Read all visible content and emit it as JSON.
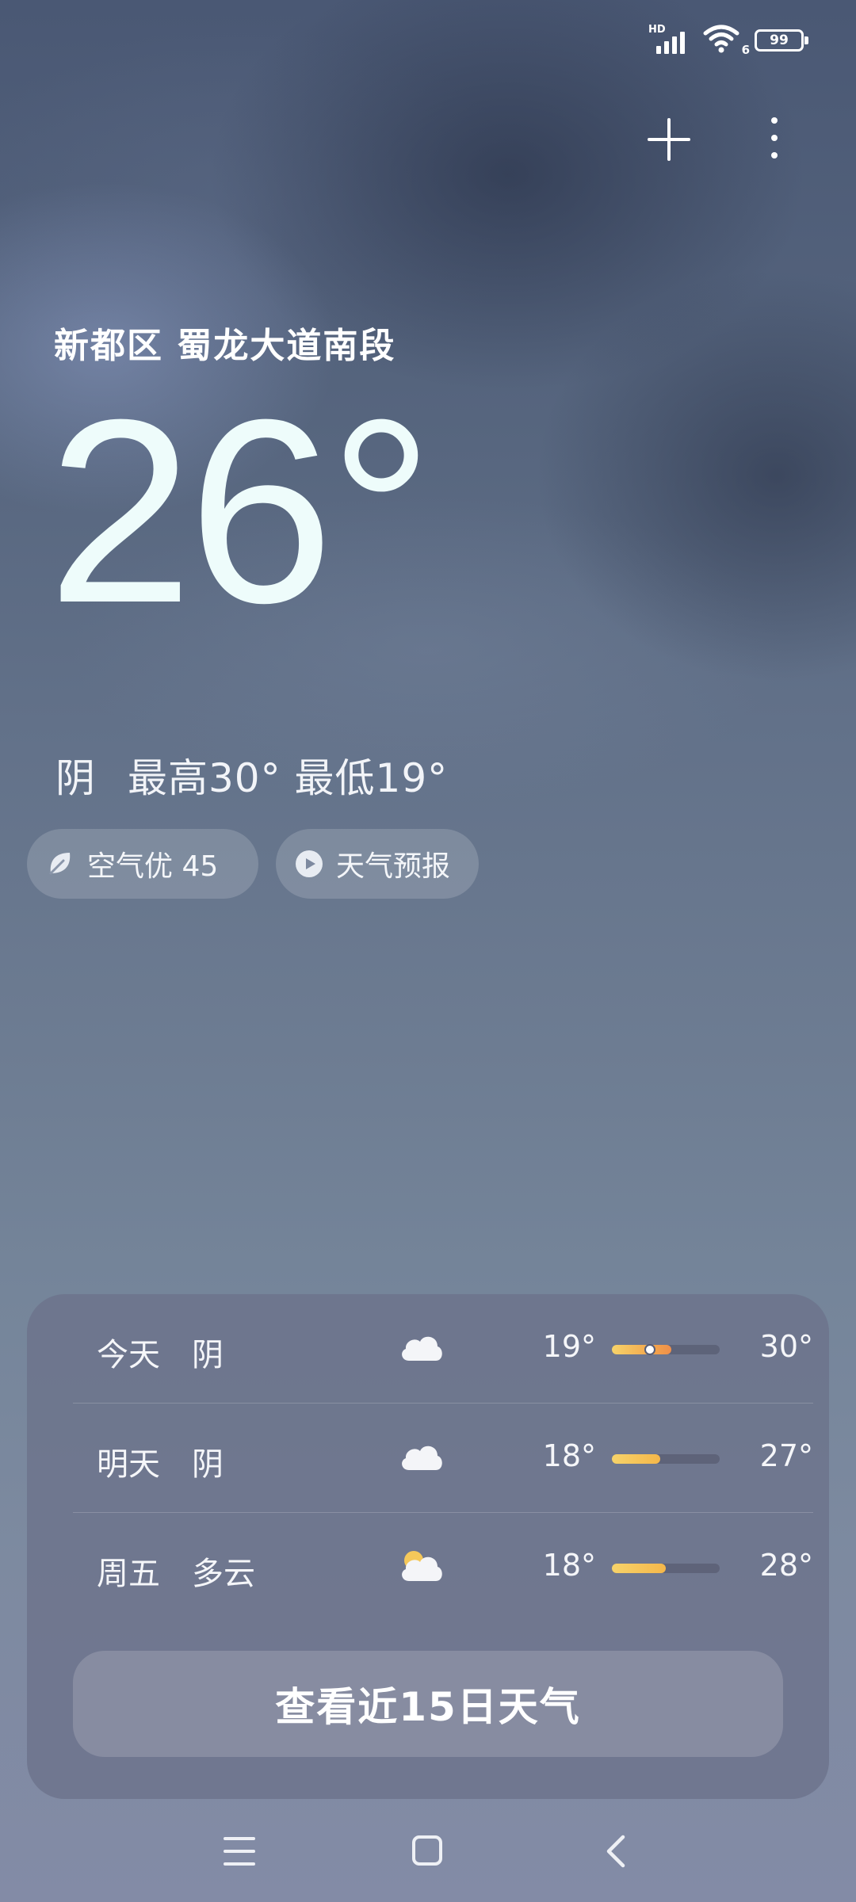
{
  "status_bar": {
    "network_label": "HD",
    "wifi_label": "6",
    "battery": "99"
  },
  "location": "新都区 蜀龙大道南段",
  "current": {
    "temperature": "26°",
    "condition": "阴",
    "high": "最高30°",
    "low": "最低19°"
  },
  "chips": {
    "air_quality": "空气优 45",
    "forecast_video": "天气预报"
  },
  "forecast": [
    {
      "day": "今天",
      "condition": "阴",
      "icon": "cloud-icon",
      "low": "19°",
      "high": "30°",
      "bar_start": 0.0,
      "bar_end": 0.55,
      "current_marker": 0.35
    },
    {
      "day": "明天",
      "condition": "阴",
      "icon": "cloud-icon",
      "low": "18°",
      "high": "27°",
      "bar_start": 0.0,
      "bar_end": 0.45
    },
    {
      "day": "周五",
      "condition": "多云",
      "icon": "partly-cloudy-icon",
      "low": "18°",
      "high": "28°",
      "bar_start": 0.0,
      "bar_end": 0.5
    }
  ],
  "cta_label": "查看近15日天气",
  "colors": {
    "bar_fill_start": "#f6d36a",
    "bar_fill_end": "#ef8f4b",
    "temperature_text": "#eefcfb"
  }
}
